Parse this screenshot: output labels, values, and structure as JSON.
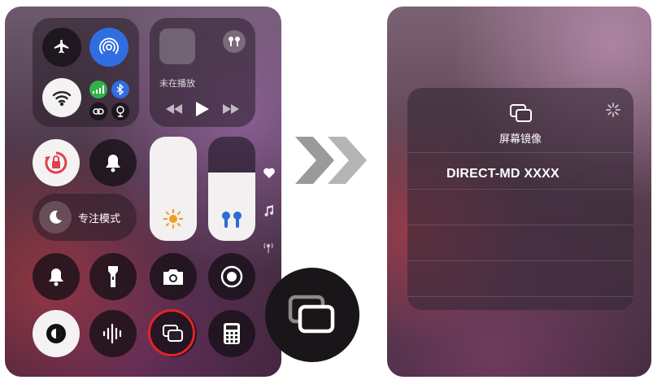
{
  "control_center": {
    "now_playing": {
      "status_text": "未在播放"
    },
    "focus": {
      "label": "专注模式"
    }
  },
  "screen_mirroring": {
    "title": "屏幕镜像",
    "devices": [
      "DIRECT-MD XXXX"
    ]
  },
  "colors": {
    "accent_blue": "#2f6de1",
    "cellular_green": "#32b14c",
    "highlight_ring": "#e22525",
    "lock_red": "#e0414f"
  },
  "icons": [
    "airplane-icon",
    "airdrop-icon",
    "wifi-icon",
    "cellular-icon",
    "bluetooth-icon",
    "link-icon",
    "vpn-icon",
    "airpods-icon",
    "rewind-icon",
    "play-icon",
    "forward-icon",
    "rotation-lock-icon",
    "bell-icon",
    "moon-icon",
    "brightness-icon",
    "heart-icon",
    "music-note-icon",
    "signal-icon",
    "flashlight-icon",
    "camera-icon",
    "record-icon",
    "dark-mode-icon",
    "sound-recognition-icon",
    "screen-mirroring-icon",
    "calculator-icon",
    "loading-spinner-icon",
    "chevron-arrows-icon"
  ]
}
